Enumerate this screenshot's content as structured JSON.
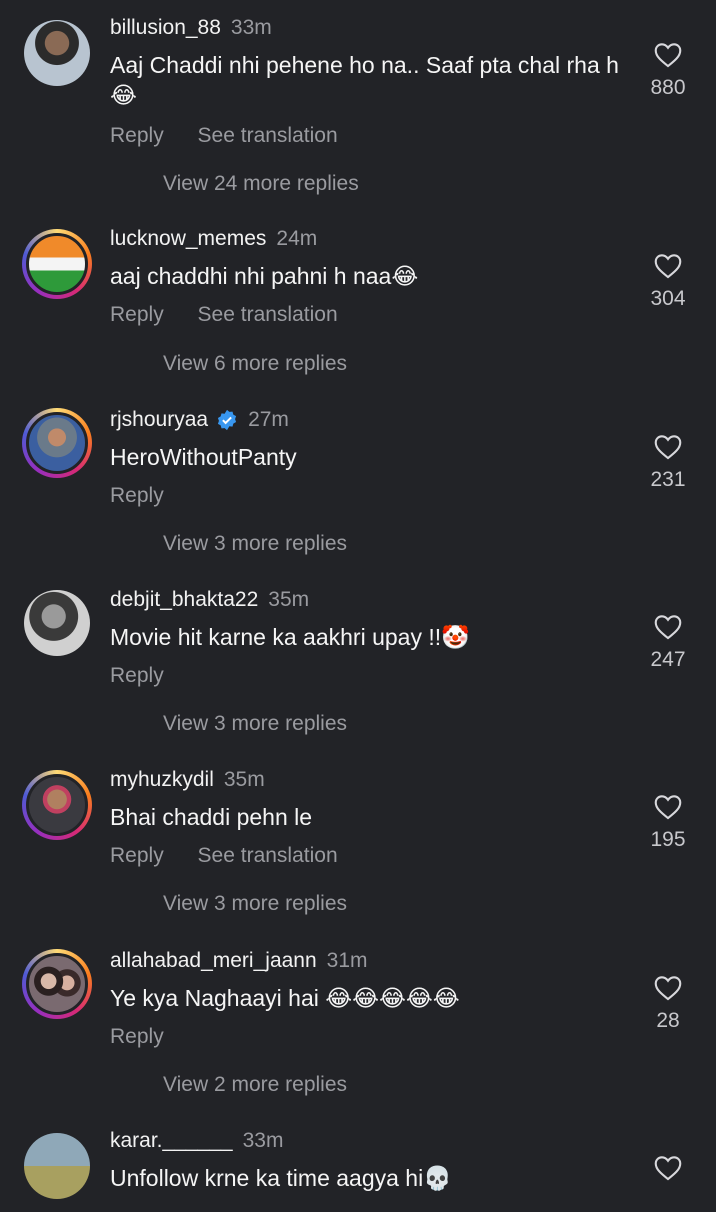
{
  "comments": [
    {
      "username": "billusion_88",
      "time": "33m",
      "text": "Aaj Chaddi nhi pehene ho na.. Saaf pta chal rha h😂",
      "reply_label": "Reply",
      "translate_label": "See translation",
      "more_replies": "View 24 more replies",
      "likes": "880",
      "verified": false
    },
    {
      "username": "lucknow_memes",
      "time": "24m",
      "text": "aaj chaddhi nhi pahni h naa😂",
      "reply_label": "Reply",
      "translate_label": "See translation",
      "more_replies": "View 6 more replies",
      "likes": "304",
      "verified": false
    },
    {
      "username": "rjshouryaa",
      "time": "27m",
      "text": "HeroWithoutPanty",
      "reply_label": "Reply",
      "translate_label": "",
      "more_replies": "View 3 more replies",
      "likes": "231",
      "verified": true
    },
    {
      "username": "debjit_bhakta22",
      "time": "35m",
      "text": "Movie hit karne ka aakhri upay !!🤡",
      "reply_label": "Reply",
      "translate_label": "",
      "more_replies": "View 3 more replies",
      "likes": "247",
      "verified": false
    },
    {
      "username": "myhuzkydil",
      "time": "35m",
      "text": "Bhai chaddi pehn le",
      "reply_label": "Reply",
      "translate_label": "See translation",
      "more_replies": "View 3 more replies",
      "likes": "195",
      "verified": false
    },
    {
      "username": "allahabad_meri_jaann",
      "time": "31m",
      "text": "Ye kya Naghaayi hai 😂😂😂😂😂",
      "reply_label": "Reply",
      "translate_label": "",
      "more_replies": "View 2 more replies",
      "likes": "28",
      "verified": false
    },
    {
      "username": "karar.______",
      "time": "33m",
      "text": "Unfollow krne ka time aagya hi💀",
      "reply_label": "",
      "translate_label": "",
      "more_replies": "",
      "likes": "",
      "verified": false
    }
  ],
  "icons": {
    "like": "heart-outline-icon",
    "verified": "verified-badge-icon"
  },
  "colors": {
    "background": "#222327",
    "text_primary": "#f5f5f5",
    "text_secondary": "#9a9ba0",
    "verified": "#3897f0"
  }
}
